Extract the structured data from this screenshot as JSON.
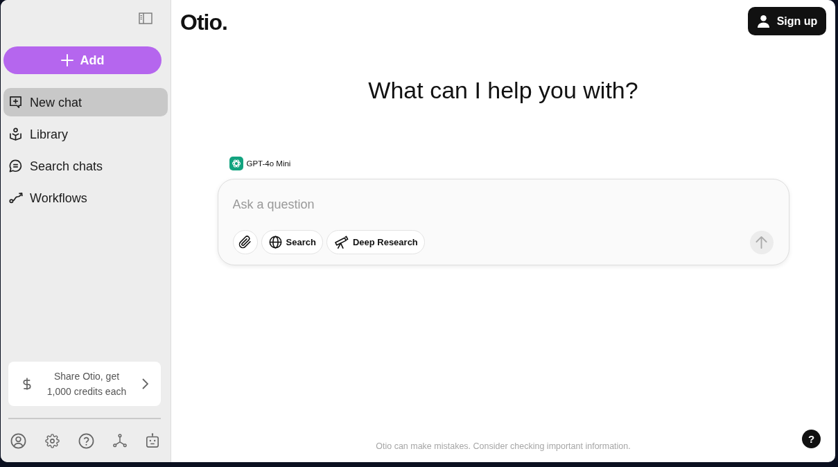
{
  "sidebar": {
    "add_button": {
      "label": "Add"
    },
    "nav_items": [
      {
        "label": "New chat",
        "selected": true
      },
      {
        "label": "Library",
        "selected": false
      },
      {
        "label": "Search chats",
        "selected": false
      },
      {
        "label": "Workflows",
        "selected": false
      }
    ],
    "promo": {
      "text": "Share Otio, get 1,000 credits each"
    }
  },
  "header": {
    "logo": "Otio.",
    "sign_up_button": {
      "label": "Sign up"
    }
  },
  "main": {
    "heading": "What can I help you with?",
    "composer": {
      "model": "GPT-4o Mini",
      "placeholder": "Ask a question",
      "tools": [
        {
          "label": "Search"
        },
        {
          "label": "Deep Research"
        }
      ],
      "send_button": {
        "disabled": true
      }
    },
    "disclaimer": "Otio can make mistakes. Consider checking important information."
  },
  "help_button": {
    "label": "?"
  }
}
